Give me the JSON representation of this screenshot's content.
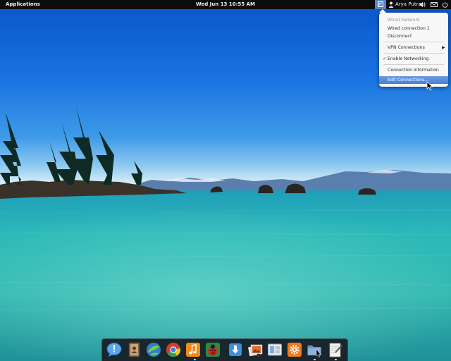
{
  "panel": {
    "applications_label": "Applications",
    "clock": "Wed Jun 13 10:55 AM",
    "user_name": "Arya Putra"
  },
  "network_menu": {
    "header": "Wired Network",
    "wired_connection": "Wired connection 1",
    "disconnect": "Disconnect",
    "vpn_connections": "VPN Connections",
    "enable_networking": "Enable Networking",
    "enable_networking_checked": true,
    "connection_information": "Connection Information",
    "edit_connections": "Edit Connections..."
  },
  "colors": {
    "panel_bg": "#0c0c0e",
    "highlight": "#4a7fd2",
    "sky_top": "#0a54c9",
    "water": "#2fb9b3"
  },
  "dock": {
    "items": [
      {
        "name": "messaging",
        "icon": "speech-bubble-icon"
      },
      {
        "name": "contacts",
        "icon": "address-book-icon"
      },
      {
        "name": "web-browser",
        "icon": "midori-icon"
      },
      {
        "name": "chrome",
        "icon": "chrome-icon"
      },
      {
        "name": "music",
        "icon": "music-note-icon"
      },
      {
        "name": "bug-tracker",
        "icon": "ladybug-icon"
      },
      {
        "name": "downloads",
        "icon": "download-arrow-icon"
      },
      {
        "name": "photos",
        "icon": "photos-icon"
      },
      {
        "name": "app-switcher",
        "icon": "window-icon"
      },
      {
        "name": "settings",
        "icon": "gear-icon"
      },
      {
        "name": "files",
        "icon": "folder-icon"
      },
      {
        "name": "text-editor",
        "icon": "notepad-icon"
      }
    ]
  }
}
